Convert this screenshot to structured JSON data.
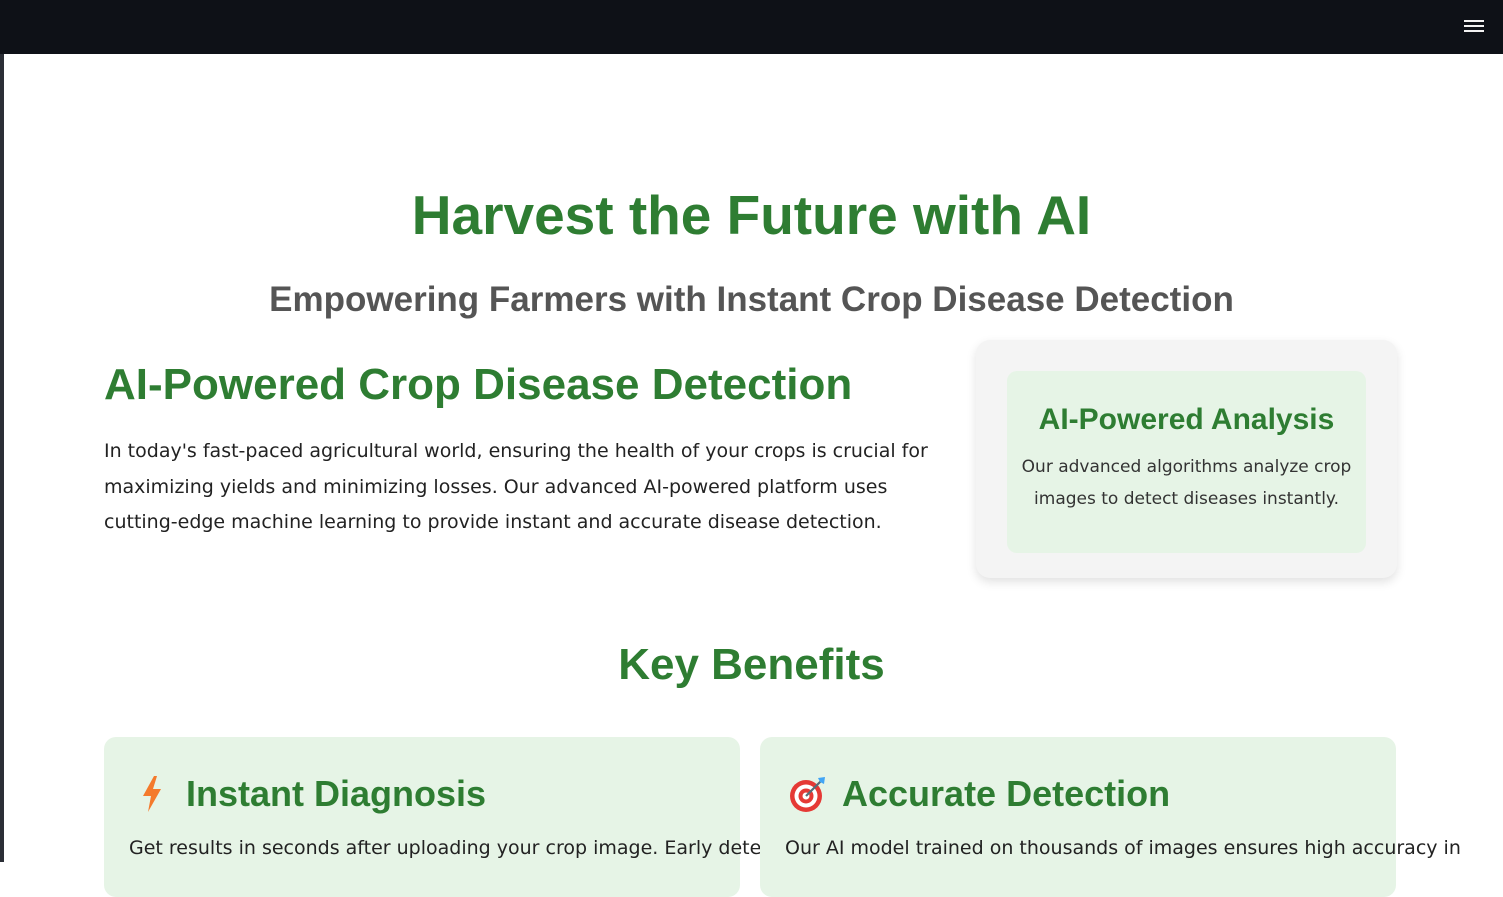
{
  "header": {
    "menu_icon": "hamburger-menu-icon"
  },
  "hero": {
    "title": "Harvest the Future with AI",
    "subtitle": "Empowering Farmers with Instant Crop Disease Detection"
  },
  "intro": {
    "title": "AI-Powered Crop Disease Detection",
    "text": "In today's fast-paced agricultural world, ensuring the health of your crops is crucial for maximizing yields and minimizing losses. Our advanced AI-powered platform uses cutting-edge machine learning to provide instant and accurate disease detection."
  },
  "analysis_card": {
    "title": "AI-Powered Analysis",
    "text": "Our advanced algorithms analyze crop images to detect diseases instantly."
  },
  "benefits": {
    "title": "Key Benefits",
    "cards": [
      {
        "icon": "lightning-bolt-icon",
        "title": "Instant Diagnosis",
        "text": "Get results in seconds after uploading your crop image. Early detection"
      },
      {
        "icon": "target-dart-icon",
        "title": "Accurate Detection",
        "text": "Our AI model trained on thousands of images ensures high accuracy in"
      }
    ]
  },
  "colors": {
    "accent_green": "#2e7d32",
    "card_background": "#e6f4e6",
    "topbar": "#0e1117"
  }
}
